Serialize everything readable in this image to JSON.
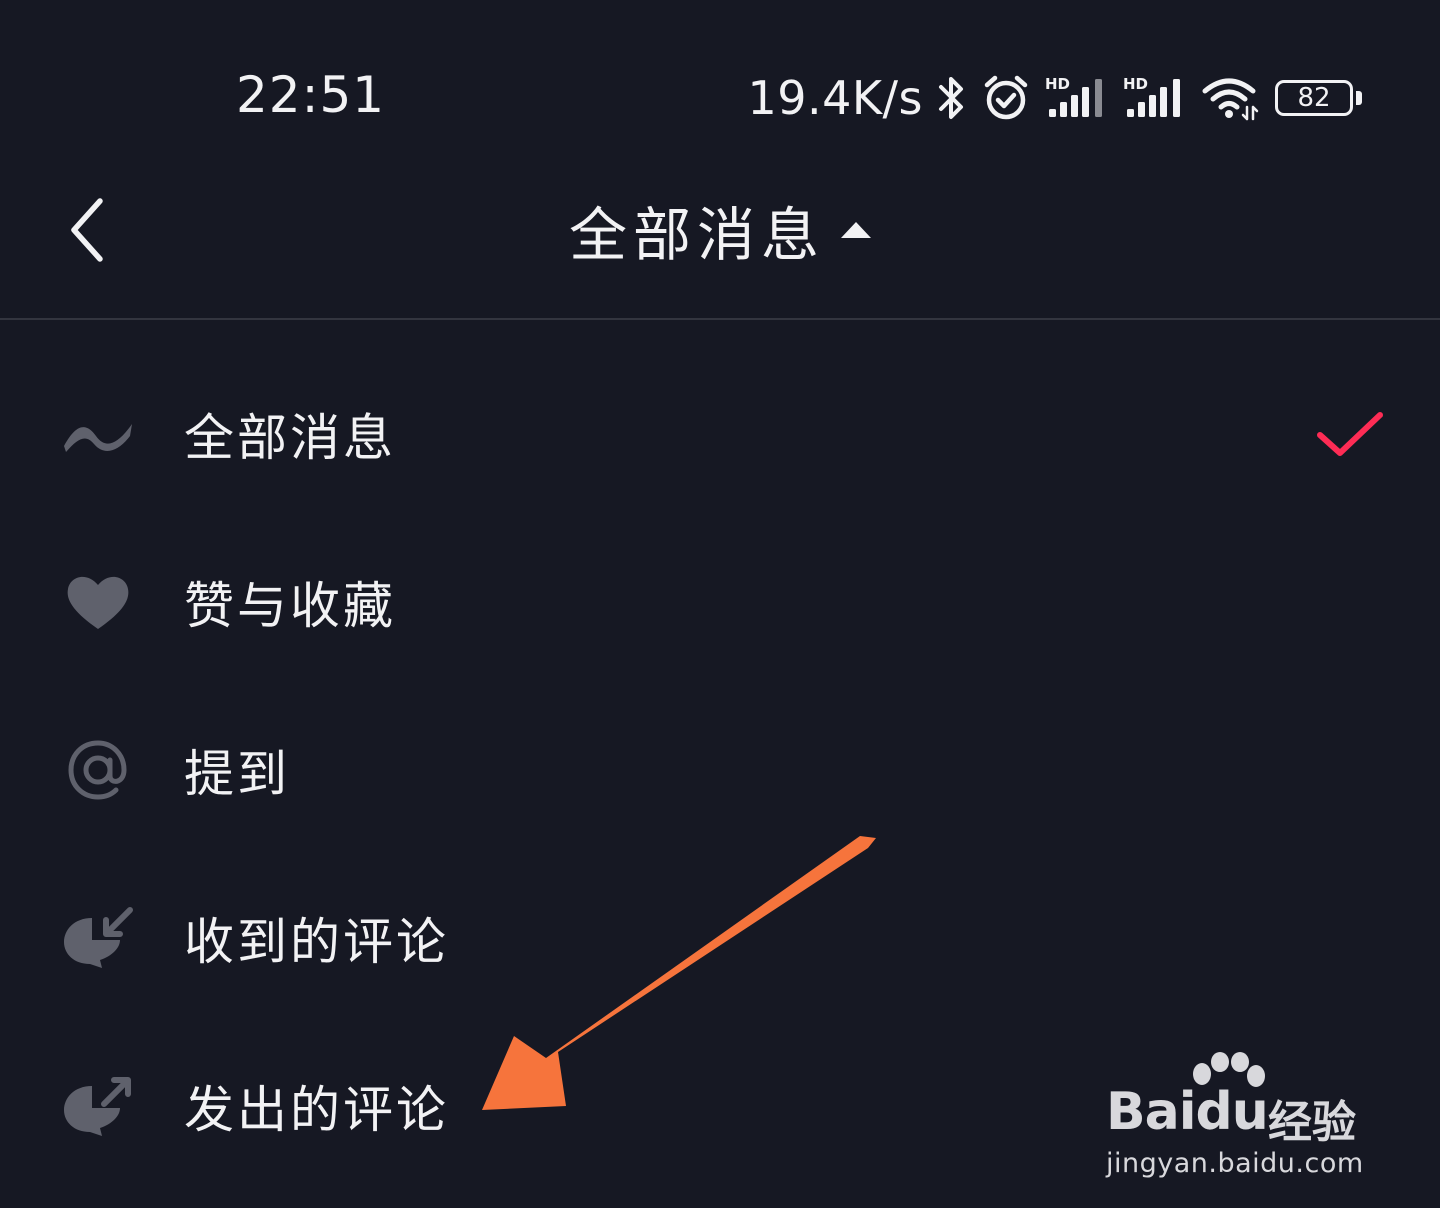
{
  "status_bar": {
    "time": "22:51",
    "network_speed": "19.4K/s",
    "battery_level": "82",
    "icons": [
      "bluetooth-icon",
      "alarm-icon",
      "signal-hd-icon",
      "signal-hd-icon",
      "wifi-icon",
      "battery-icon"
    ]
  },
  "nav": {
    "back_icon": "chevron-left-icon",
    "title": "全部消息",
    "title_indicator": "caret-up-icon"
  },
  "menu": {
    "items": [
      {
        "label": "全部消息",
        "icon": "wave-icon",
        "selected": true
      },
      {
        "label": "赞与收藏",
        "icon": "heart-icon",
        "selected": false
      },
      {
        "label": "提到",
        "icon": "at-icon",
        "selected": false
      },
      {
        "label": "收到的评论",
        "icon": "comment-received-icon",
        "selected": false
      },
      {
        "label": "发出的评论",
        "icon": "comment-sent-icon",
        "selected": false
      }
    ],
    "selected_check_icon": "checkmark-icon"
  },
  "colors": {
    "background": "#161823",
    "text": "#f2f2f4",
    "icon": "#5f616c",
    "check": "#fe2c55",
    "annotation_arrow": "#f6743c"
  },
  "watermark": {
    "brand": "Baidu",
    "brand_suffix": "经验",
    "url": "jingyan.baidu.com"
  }
}
